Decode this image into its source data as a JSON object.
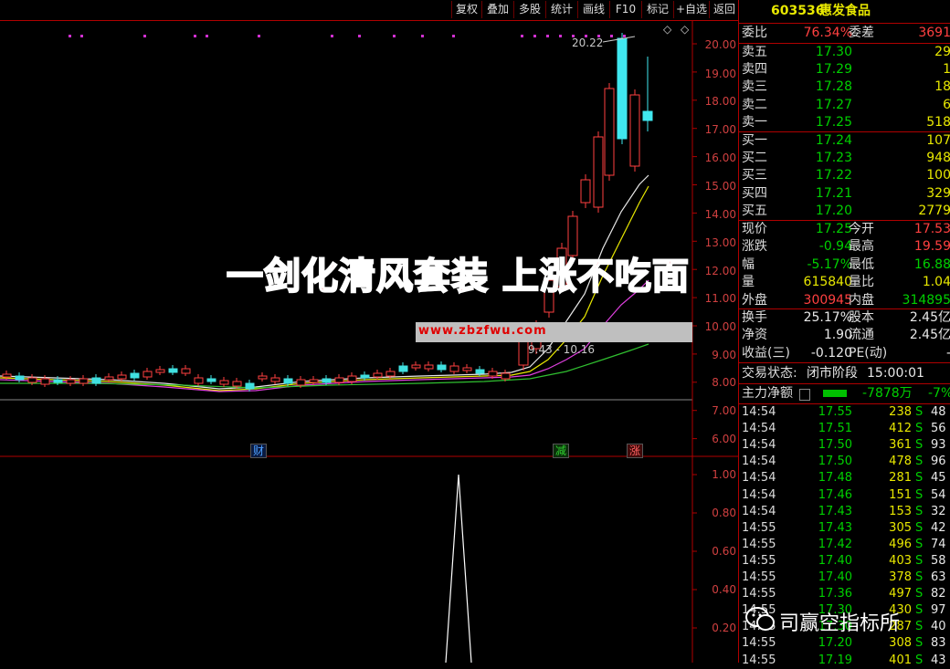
{
  "toolbar": {
    "buttons": [
      "复权",
      "叠加",
      "多股",
      "统计",
      "画线",
      "F10",
      "标记",
      "+自选",
      "返回"
    ]
  },
  "stock": {
    "code": "603536",
    "name": "惠发食品"
  },
  "order_ratio": {
    "label": "委比",
    "value": "76.34%",
    "diff_label": "委差",
    "diff_value": "3691"
  },
  "asks": [
    {
      "label": "卖五",
      "price": "17.30",
      "vol": "29"
    },
    {
      "label": "卖四",
      "price": "17.29",
      "vol": "1"
    },
    {
      "label": "卖三",
      "price": "17.28",
      "vol": "18"
    },
    {
      "label": "卖二",
      "price": "17.27",
      "vol": "6"
    },
    {
      "label": "卖一",
      "price": "17.25",
      "vol": "518"
    }
  ],
  "bids": [
    {
      "label": "买一",
      "price": "17.24",
      "vol": "107"
    },
    {
      "label": "买二",
      "price": "17.23",
      "vol": "948"
    },
    {
      "label": "买三",
      "price": "17.22",
      "vol": "100"
    },
    {
      "label": "买四",
      "price": "17.21",
      "vol": "329"
    },
    {
      "label": "买五",
      "price": "17.20",
      "vol": "2779"
    }
  ],
  "quote": [
    {
      "l1": "现价",
      "v1": "17.25",
      "l2": "今开",
      "v2": "17.53"
    },
    {
      "l1": "涨跌",
      "v1": "-0.94",
      "l2": "最高",
      "v2": "19.59"
    },
    {
      "l1": "幅",
      "v1": "-5.17%",
      "l2": "最低",
      "v2": "16.88"
    },
    {
      "l1": "量",
      "v1": "615840",
      "l2": "量比",
      "v2": "1.04"
    },
    {
      "l1": "外盘",
      "v1": "300945",
      "l2": "内盘",
      "v2": "314895"
    }
  ],
  "fundamentals": [
    {
      "l1": "换手",
      "v1": "25.17%",
      "l2": "股本",
      "v2": "2.45亿"
    },
    {
      "l1": "净资",
      "v1": "1.90",
      "l2": "流通",
      "v2": "2.45亿"
    },
    {
      "l1": "收益(三)",
      "v1": "-0.120",
      "l2": "PE(动)",
      "v2": "-"
    }
  ],
  "trade_status": {
    "label": "交易状态:",
    "value": "闭市阶段",
    "time": "15:00:01"
  },
  "main_flow": {
    "label": "主力净额",
    "value": "-7878万",
    "pct": "-7%"
  },
  "ticks": [
    {
      "t": "14:54",
      "p": "17.55",
      "v": "238",
      "s": "S",
      "n": "48"
    },
    {
      "t": "14:54",
      "p": "17.51",
      "v": "412",
      "s": "S",
      "n": "56"
    },
    {
      "t": "14:54",
      "p": "17.50",
      "v": "361",
      "s": "S",
      "n": "93"
    },
    {
      "t": "14:54",
      "p": "17.50",
      "v": "478",
      "s": "S",
      "n": "96"
    },
    {
      "t": "14:54",
      "p": "17.48",
      "v": "281",
      "s": "S",
      "n": "45"
    },
    {
      "t": "14:54",
      "p": "17.46",
      "v": "151",
      "s": "S",
      "n": "54"
    },
    {
      "t": "14:54",
      "p": "17.43",
      "v": "153",
      "s": "S",
      "n": "32"
    },
    {
      "t": "14:55",
      "p": "17.43",
      "v": "305",
      "s": "S",
      "n": "42"
    },
    {
      "t": "14:55",
      "p": "17.42",
      "v": "496",
      "s": "S",
      "n": "74"
    },
    {
      "t": "14:55",
      "p": "17.40",
      "v": "403",
      "s": "S",
      "n": "58"
    },
    {
      "t": "14:55",
      "p": "17.40",
      "v": "378",
      "s": "S",
      "n": "63"
    },
    {
      "t": "14:55",
      "p": "17.36",
      "v": "497",
      "s": "S",
      "n": "82"
    },
    {
      "t": "14:55",
      "p": "17.30",
      "v": "430",
      "s": "S",
      "n": "97"
    },
    {
      "t": "14:55",
      "p": "17.30",
      "v": "287",
      "s": "S",
      "n": "40"
    },
    {
      "t": "14:55",
      "p": "17.20",
      "v": "308",
      "s": "S",
      "n": "83"
    },
    {
      "t": "14:55",
      "p": "17.19",
      "v": "401",
      "s": "S",
      "n": "43"
    }
  ],
  "chart": {
    "price_ticks": [
      "20.00",
      "19.00",
      "18.00",
      "17.00",
      "16.00",
      "15.00",
      "14.00",
      "13.00",
      "12.00",
      "11.00",
      "10.00",
      "9.00",
      "8.00",
      "7.00",
      "6.00"
    ],
    "ind_ticks": [
      "1.00",
      "0.80",
      "0.60",
      "0.40",
      "0.20"
    ],
    "high_label": "20.22",
    "range_label": "9.43 - 10.16",
    "events": [
      "财",
      "减",
      "涨"
    ]
  },
  "overlay": {
    "headline": "一剑化清风套装 上涨不吃面",
    "url": "www.zbzfwu.com"
  },
  "brand": {
    "name": "司赢空指标所"
  }
}
